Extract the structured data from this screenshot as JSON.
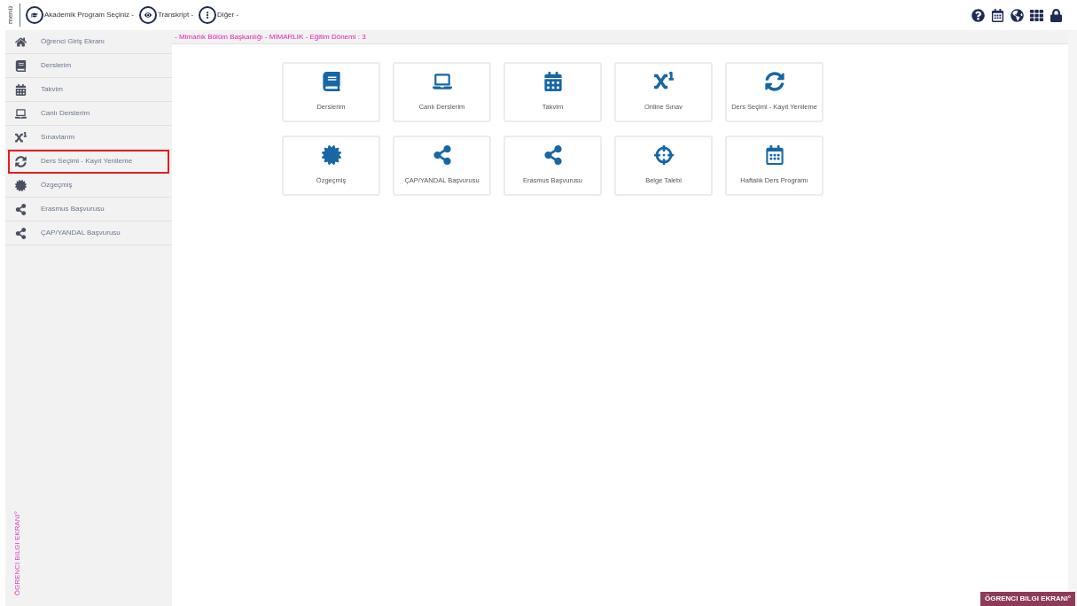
{
  "topbar": {
    "menu_label": "menü",
    "menus": [
      {
        "label": "Akademik Program Seçiniz -"
      },
      {
        "label": "Transkript -"
      },
      {
        "label": "Diğer -"
      }
    ]
  },
  "sidebar": {
    "items": [
      {
        "label": "Öğrenci Giriş Ekranı",
        "selected": false
      },
      {
        "label": "Derslerim",
        "selected": false
      },
      {
        "label": "Takvim",
        "selected": false
      },
      {
        "label": "Canlı Derslerim",
        "selected": false
      },
      {
        "label": "Sınavlarım",
        "selected": false
      },
      {
        "label": "Ders Seçimi - Kayıt Yenileme",
        "selected": true
      },
      {
        "label": "Özgeçmiş",
        "selected": false
      },
      {
        "label": "Erasmus Başvurusu",
        "selected": false
      },
      {
        "label": "ÇAP/YANDAL Başvurusu",
        "selected": false
      }
    ],
    "vertical_label": "ÖGRENCI BILGI EKRANI°"
  },
  "breadcrumb": "- Mimarlık Bölüm Başkanlığı - MİMARLIK - Eğitim Dönemi : 3",
  "tiles": [
    {
      "label": "Derslerim"
    },
    {
      "label": "Canlı Derslerim"
    },
    {
      "label": "Takvim"
    },
    {
      "label": "Online Sınav"
    },
    {
      "label": "Ders Seçimi - Kayıt Yenileme"
    },
    {
      "label": "Özgeçmiş"
    },
    {
      "label": "ÇAP/YANDAL Başvurusu"
    },
    {
      "label": "Erasmus Başvurusu"
    },
    {
      "label": "Belge Talebi"
    },
    {
      "label": "Haftalık Ders Programı"
    }
  ],
  "footer_badge": "ÖGRENCI BILGI EKRANI°"
}
